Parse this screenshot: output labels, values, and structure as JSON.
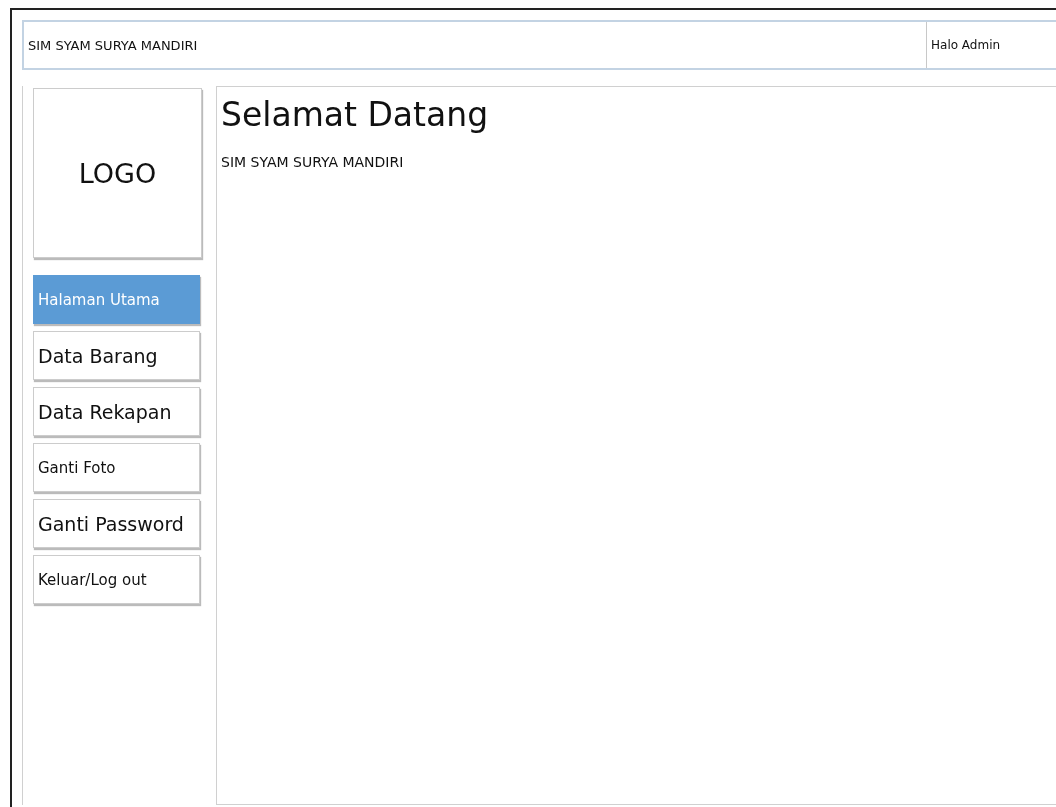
{
  "header": {
    "title": "SIM SYAM SURYA MANDIRI",
    "greeting": "Halo Admin"
  },
  "sidebar": {
    "logo": "LOGO",
    "items": [
      {
        "label": "Halaman Utama",
        "selected": true,
        "kind": "small"
      },
      {
        "label": "Data Barang",
        "selected": false,
        "kind": "large"
      },
      {
        "label": "Data Rekapan",
        "selected": false,
        "kind": "large"
      },
      {
        "label": "Ganti Foto",
        "selected": false,
        "kind": "small"
      },
      {
        "label": "Ganti Password",
        "selected": false,
        "kind": "large"
      },
      {
        "label": "Keluar/Log out",
        "selected": false,
        "kind": "small"
      }
    ]
  },
  "main": {
    "heading": "Selamat Datang",
    "subtitle": "SIM SYAM SURYA MANDIRI"
  }
}
